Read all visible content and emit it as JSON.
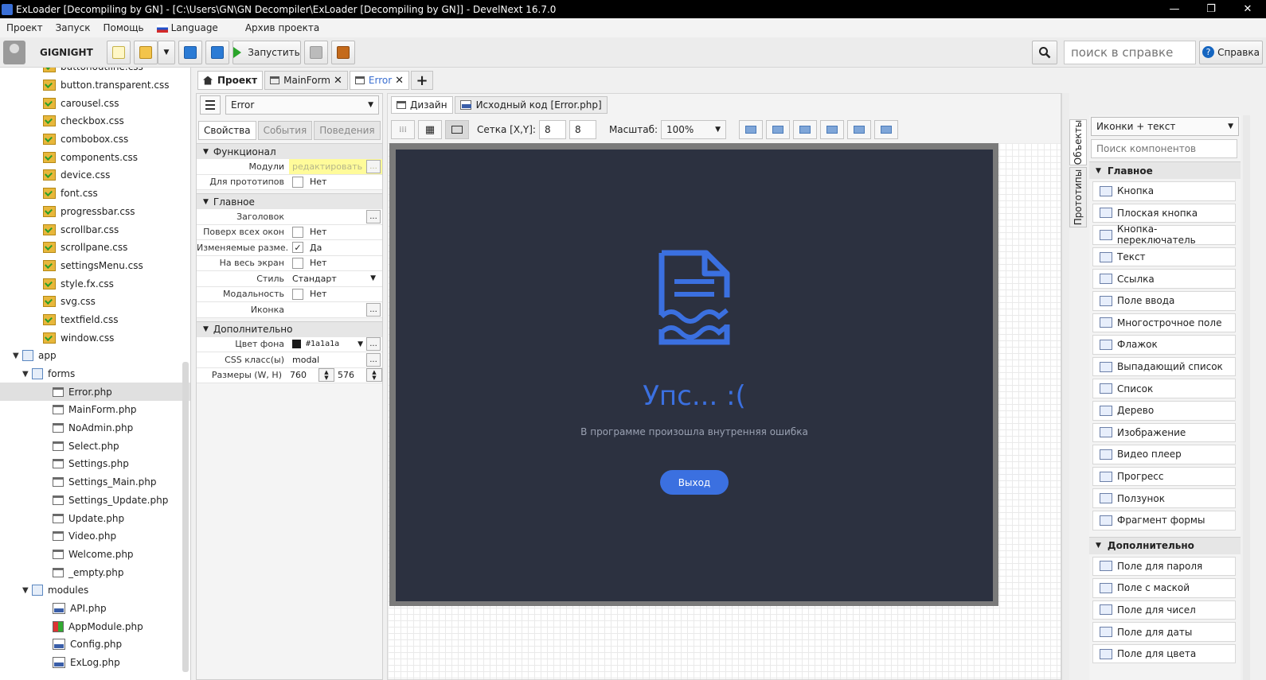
{
  "window": {
    "title": "ExLoader [Decompiling by GN] - [C:\\Users\\GN\\GN Decompiler\\ExLoader [Decompiling by GN]] - DevelNext 16.7.0",
    "minimize": "—",
    "maximize": "❐",
    "close": "✕"
  },
  "menu": {
    "items": [
      "Проект",
      "Запуск",
      "Помощь"
    ],
    "language": "Language",
    "archive": "Архив проекта"
  },
  "toolbar": {
    "username": "GIGNIGHT",
    "run_label": "Запустить",
    "search_placeholder": "поиск в справке",
    "help_label": "Справка"
  },
  "tree": {
    "items": [
      {
        "label": "buttonoutline.css",
        "type": "css",
        "depth": 1
      },
      {
        "label": "button.transparent.css",
        "type": "css",
        "depth": 1
      },
      {
        "label": "carousel.css",
        "type": "css",
        "depth": 1
      },
      {
        "label": "checkbox.css",
        "type": "css",
        "depth": 1
      },
      {
        "label": "combobox.css",
        "type": "css",
        "depth": 1
      },
      {
        "label": "components.css",
        "type": "css",
        "depth": 1
      },
      {
        "label": "device.css",
        "type": "css",
        "depth": 1
      },
      {
        "label": "font.css",
        "type": "css",
        "depth": 1
      },
      {
        "label": "progressbar.css",
        "type": "css",
        "depth": 1
      },
      {
        "label": "scrollbar.css",
        "type": "css",
        "depth": 1
      },
      {
        "label": "scrollpane.css",
        "type": "css",
        "depth": 1
      },
      {
        "label": "settingsMenu.css",
        "type": "css",
        "depth": 1
      },
      {
        "label": "style.fx.css",
        "type": "css",
        "depth": 1
      },
      {
        "label": "svg.css",
        "type": "css",
        "depth": 1
      },
      {
        "label": "textfield.css",
        "type": "css",
        "depth": 1
      },
      {
        "label": "window.css",
        "type": "css",
        "depth": 1
      },
      {
        "label": "app",
        "type": "folder",
        "depth": 0,
        "expanded": true
      },
      {
        "label": "forms",
        "type": "folder",
        "depth": 1,
        "expanded": true
      },
      {
        "label": "Error.php",
        "type": "form",
        "depth": 2,
        "selected": true
      },
      {
        "label": "MainForm.php",
        "type": "form",
        "depth": 2
      },
      {
        "label": "NoAdmin.php",
        "type": "form",
        "depth": 2
      },
      {
        "label": "Select.php",
        "type": "form",
        "depth": 2
      },
      {
        "label": "Settings.php",
        "type": "form",
        "depth": 2
      },
      {
        "label": "Settings_Main.php",
        "type": "form",
        "depth": 2
      },
      {
        "label": "Settings_Update.php",
        "type": "form",
        "depth": 2
      },
      {
        "label": "Update.php",
        "type": "form",
        "depth": 2
      },
      {
        "label": "Video.php",
        "type": "form",
        "depth": 2
      },
      {
        "label": "Welcome.php",
        "type": "form",
        "depth": 2
      },
      {
        "label": "_empty.php",
        "type": "form",
        "depth": 2
      },
      {
        "label": "modules",
        "type": "folder",
        "depth": 1,
        "expanded": true
      },
      {
        "label": "API.php",
        "type": "php",
        "depth": 2
      },
      {
        "label": "AppModule.php",
        "type": "app",
        "depth": 2
      },
      {
        "label": "Config.php",
        "type": "php",
        "depth": 2
      },
      {
        "label": "ExLog.php",
        "type": "php",
        "depth": 2
      }
    ]
  },
  "editor_tabs": {
    "project": "Проект",
    "mainform": "MainForm",
    "error": "Error",
    "close": "✕",
    "add": "+"
  },
  "props": {
    "object": "Error",
    "tabs": [
      "Свойства",
      "События",
      "Поведения"
    ],
    "sections": {
      "func": "Функционал",
      "main": "Главное",
      "extra": "Дополнительно"
    },
    "func_rows": {
      "modules_label": "Модули",
      "modules_value": "редактировать",
      "proto_label": "Для прототипов",
      "proto_value": "Нет"
    },
    "main_rows": {
      "title_label": "Заголовок",
      "ontop_label": "Поверх всех окон",
      "ontop_value": "Нет",
      "resizable_label": "Изменяемые разме...",
      "resizable_value": "Да",
      "fullscreen_label": "На весь экран",
      "fullscreen_value": "Нет",
      "style_label": "Стиль",
      "style_value": "Стандарт",
      "modal_label": "Модальность",
      "modal_value": "Нет",
      "icon_label": "Иконка"
    },
    "extra_rows": {
      "bg_label": "Цвет фона",
      "bg_value": "#1a1a1a",
      "css_label": "CSS класс(ы)",
      "css_value": "modal",
      "size_label": "Размеры (W, H)",
      "width": "760",
      "height": "576"
    },
    "dots": "..."
  },
  "design": {
    "tab_design": "Дизайн",
    "tab_source": "Исходный код [Error.php]",
    "grid_label": "Сетка [X,Y]:",
    "grid_x": "8",
    "grid_y": "8",
    "zoom_label": "Масштаб:",
    "zoom_value": "100%"
  },
  "form_preview": {
    "heading": "Упс... :(",
    "message": "В программе произошла внутренняя ошибка",
    "button": "Выход",
    "accent_color": "#3b70e0",
    "background_color": "#2c3140"
  },
  "side_tabs": {
    "objects": "Объекты",
    "prototypes": "Прототипы"
  },
  "palette": {
    "view_mode": "Иконки + текст",
    "search_placeholder": "Поиск компонентов",
    "section_main": "Главное",
    "main_items": [
      "Кнопка",
      "Плоская кнопка",
      "Кнопка-переключатель",
      "Текст",
      "Ссылка",
      "Поле ввода",
      "Многострочное поле",
      "Флажок",
      "Выпадающий список",
      "Список",
      "Дерево",
      "Изображение",
      "Видео плеер",
      "Прогресс",
      "Ползунок",
      "Фрагмент формы"
    ],
    "section_extra": "Дополнительно",
    "extra_items": [
      "Поле для пароля",
      "Поле с маской",
      "Поле для чисел",
      "Поле для даты",
      "Поле для цвета"
    ]
  }
}
